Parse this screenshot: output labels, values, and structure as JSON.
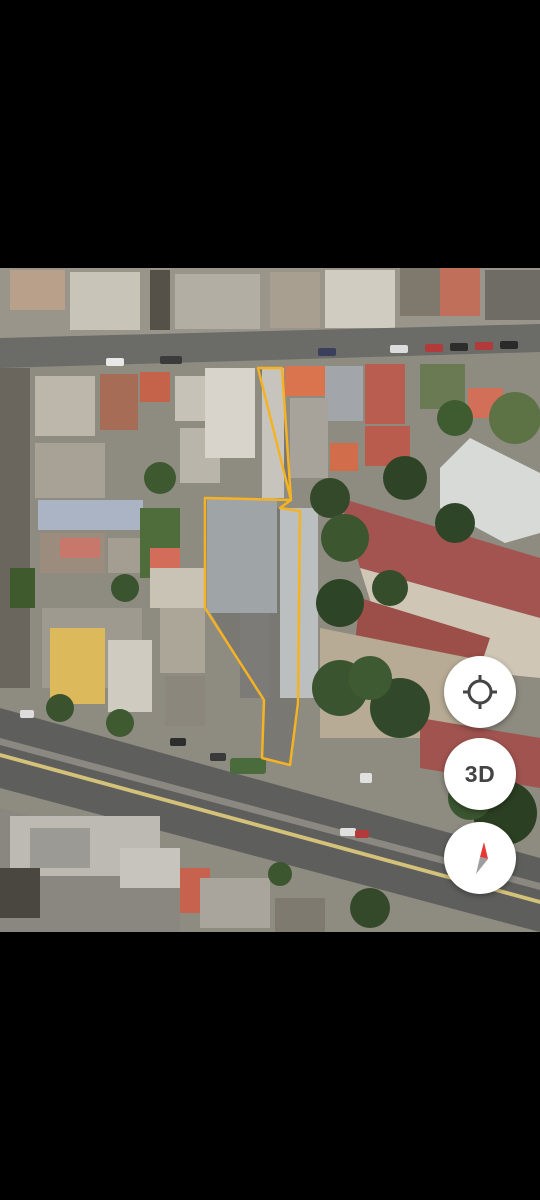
{
  "map": {
    "view_type": "satellite",
    "parcel_outline_color": "#f5b324"
  },
  "controls": {
    "locate": {
      "icon": "crosshair-locate-icon"
    },
    "view3d": {
      "label": "3D"
    },
    "compass": {
      "icon": "compass-icon",
      "north_color": "#e53935",
      "south_color": "#9e9e9e"
    }
  }
}
